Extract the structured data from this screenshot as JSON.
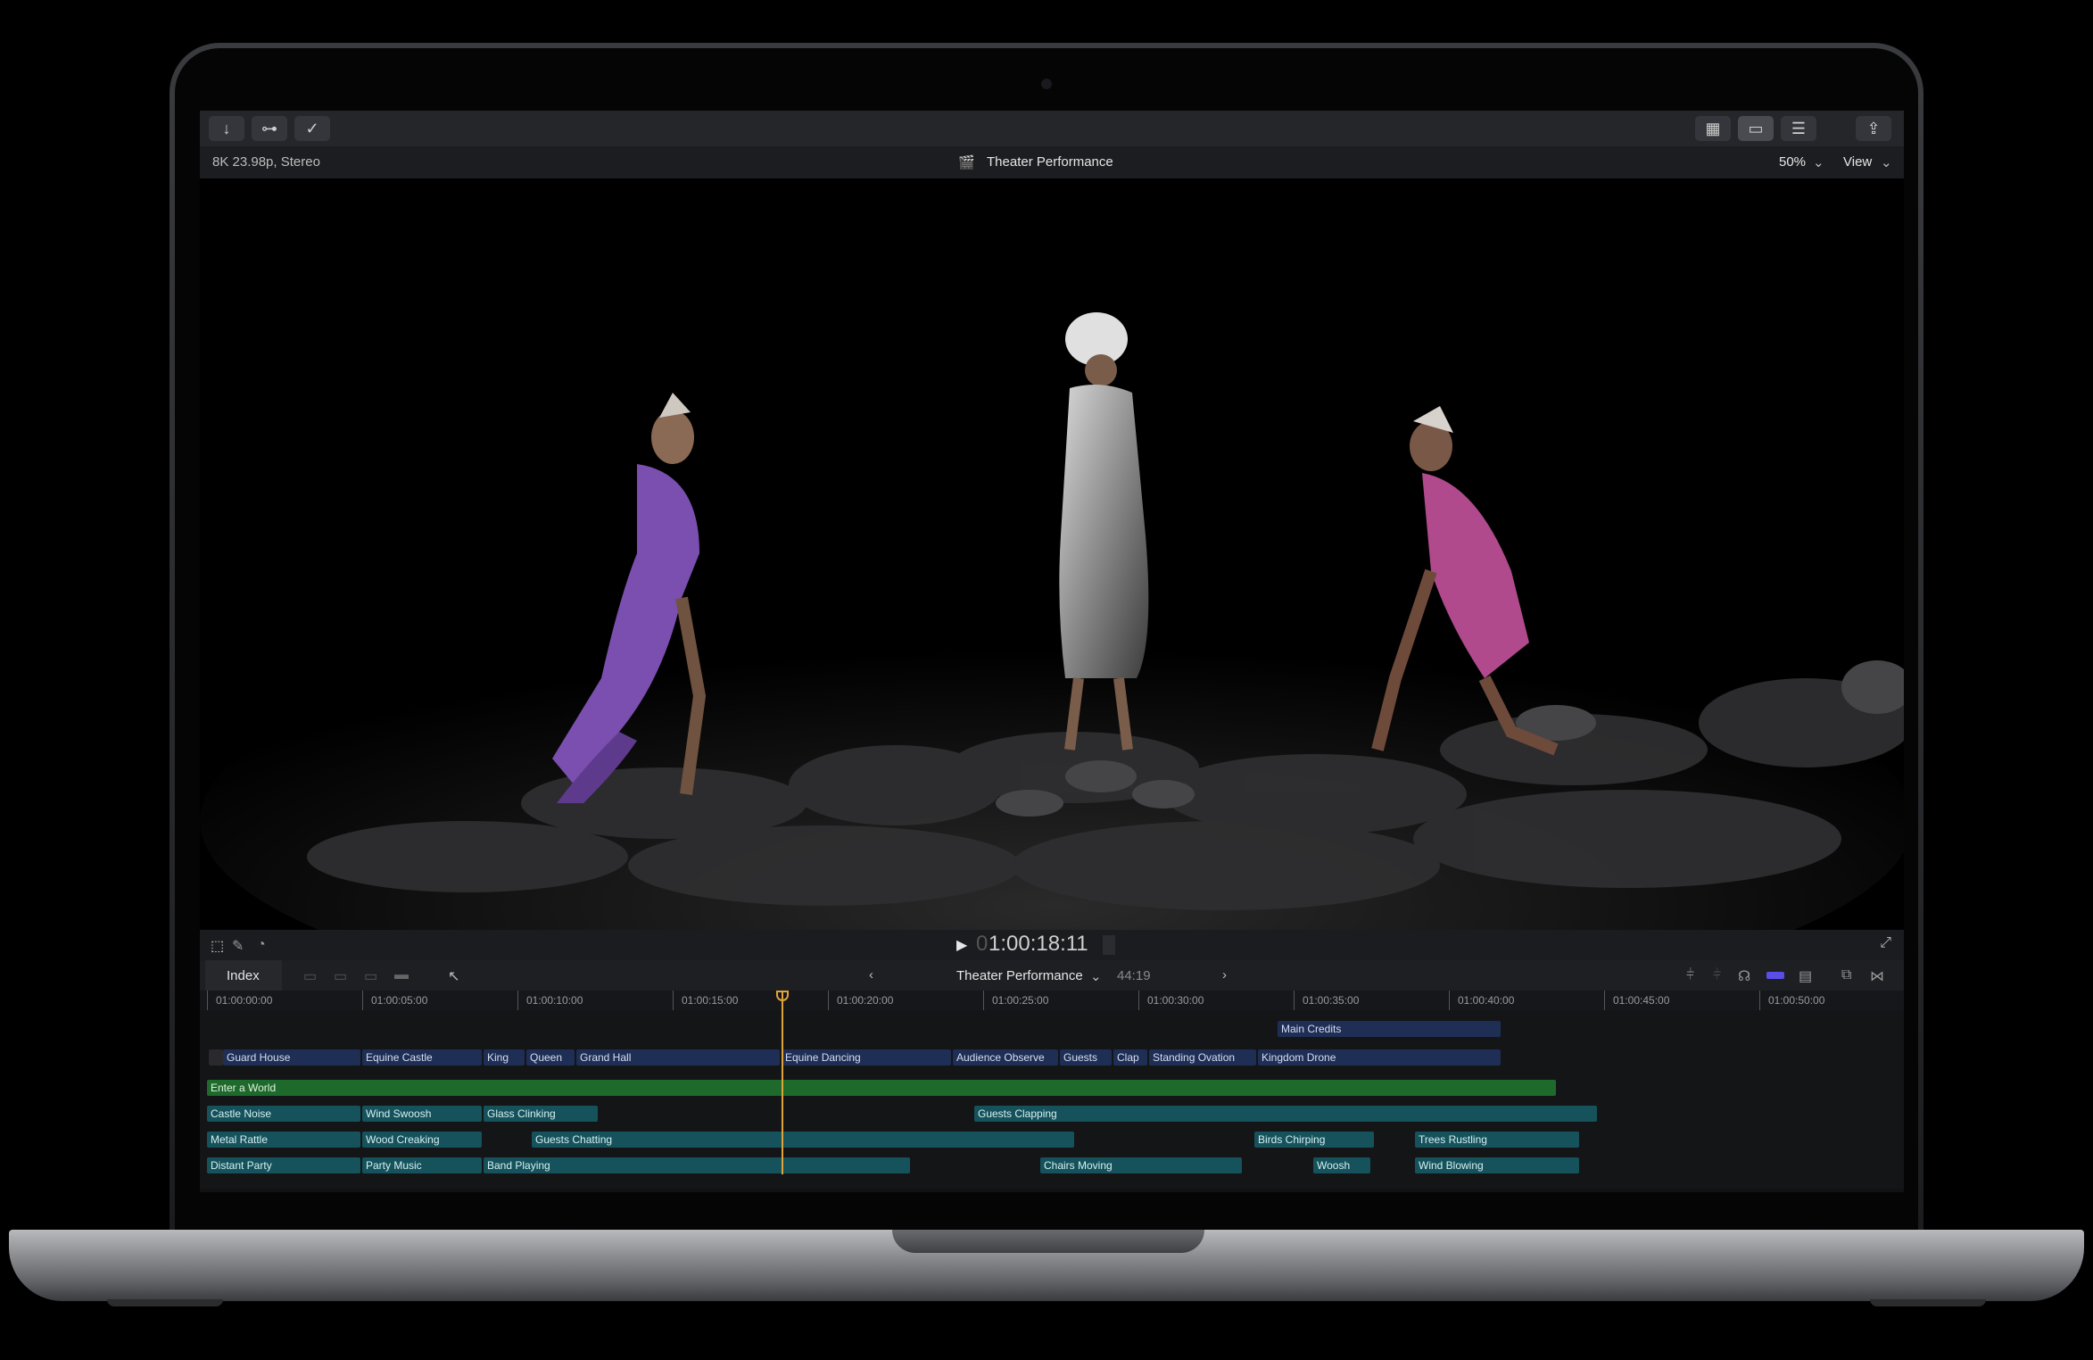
{
  "window": {
    "format_info": "8K 23.98p, Stereo",
    "project_title": "Theater Performance",
    "zoom": "50%",
    "view_menu": "View"
  },
  "toolbar": {
    "left_icons": [
      "import-icon",
      "keyword-icon",
      "background-tasks-icon"
    ],
    "right_icons": [
      "browser-grid-icon",
      "timeline-icon",
      "inspector-icon",
      "share-icon"
    ]
  },
  "playback": {
    "timecode": "1:00:18:11",
    "timecode_dim_prefix": "0"
  },
  "timeline": {
    "index_label": "Index",
    "project_name": "Theater Performance",
    "duration": "44:19",
    "ruler_labels": [
      "01:00:00:00",
      "01:00:05:00",
      "01:00:10:00",
      "01:00:15:00",
      "01:00:20:00",
      "01:00:25:00",
      "01:00:30:00",
      "01:00:35:00",
      "01:00:40:00",
      "01:00:45:00",
      "01:00:50:00"
    ],
    "title_clips": [
      "Main Credits"
    ],
    "video_clips": [
      "Guard House",
      "Equine Castle",
      "King",
      "Queen",
      "Grand Hall",
      "Equine Dancing",
      "Audience Observe",
      "Guests",
      "Clap",
      "Standing Ovation",
      "Kingdom Drone"
    ],
    "music_clips": [
      "Enter a World"
    ],
    "audio_row1": [
      "Castle Noise",
      "Wind Swoosh",
      "Glass Clinking",
      "Guests Clapping"
    ],
    "audio_row2": [
      "Metal Rattle",
      "Wood Creaking",
      "Guests Chatting",
      "Birds Chirping",
      "Trees Rustling"
    ],
    "audio_row3": [
      "Distant Party",
      "Party Music",
      "Band Playing",
      "Chairs Moving",
      "Woosh",
      "Wind Blowing"
    ]
  },
  "colors": {
    "playhead": "#e0a43a",
    "video_clip": "#1f2e55",
    "music_clip": "#1e6a2c",
    "audio_clip": "#15525c",
    "skimmer_accent": "#5b4de8"
  }
}
